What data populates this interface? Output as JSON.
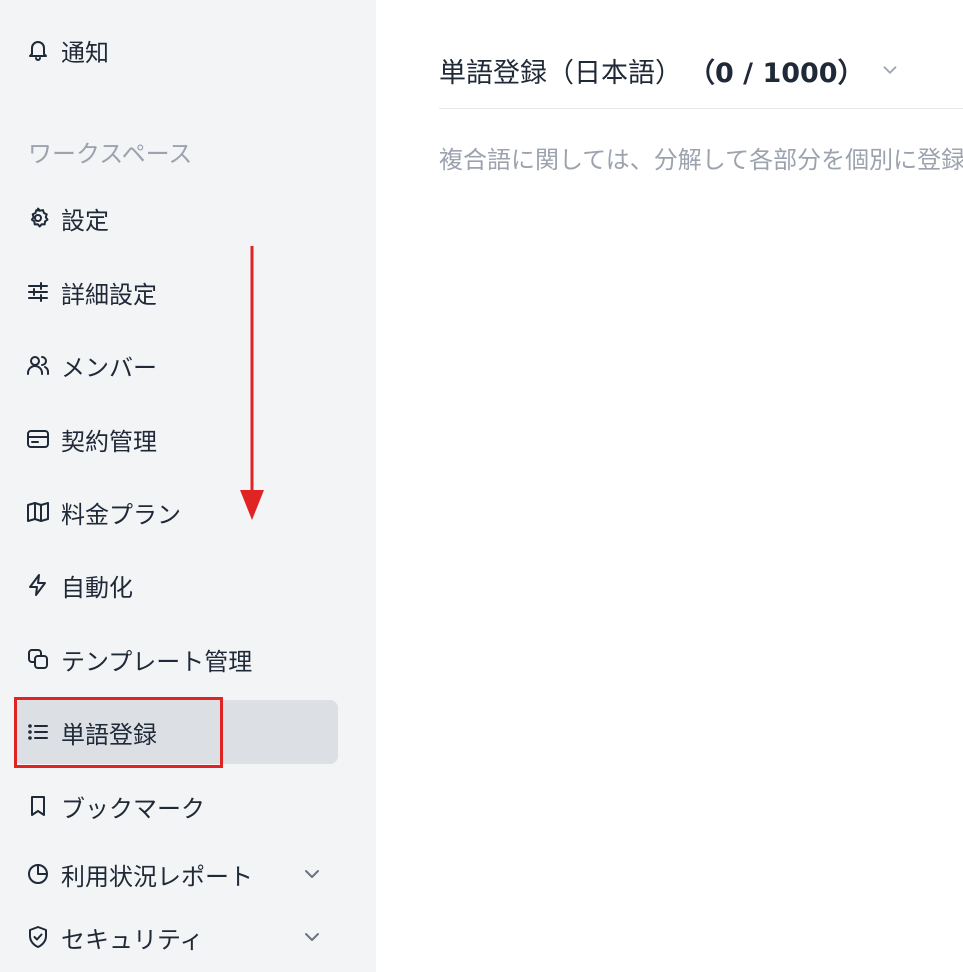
{
  "sidebar": {
    "notification": {
      "label": "通知",
      "icon": "bell-icon"
    },
    "section_heading": "ワークスペース",
    "items": [
      {
        "label": "設定",
        "icon": "gear-icon"
      },
      {
        "label": "詳細設定",
        "icon": "sliders-icon"
      },
      {
        "label": "メンバー",
        "icon": "users-icon"
      },
      {
        "label": "契約管理",
        "icon": "credit-card-icon"
      },
      {
        "label": "料金プラン",
        "icon": "map-icon"
      },
      {
        "label": "自動化",
        "icon": "lightning-icon"
      },
      {
        "label": "テンプレート管理",
        "icon": "copy-icon"
      },
      {
        "label": "単語登録",
        "icon": "list-icon",
        "active": true
      },
      {
        "label": "ブックマーク",
        "icon": "bookmark-icon"
      },
      {
        "label": "利用状況レポート",
        "icon": "pie-chart-icon",
        "expandable": true
      },
      {
        "label": "セキュリティ",
        "icon": "shield-check-icon",
        "expandable": true
      }
    ]
  },
  "main": {
    "title": "単語登録（日本語）",
    "count": "（0 / 1000）",
    "description": "複合語に関しては、分解して各部分を個別に登録"
  },
  "colors": {
    "sidebar_bg": "#f3f4f6",
    "active_bg": "#dcdfe4",
    "annotation_red": "#e02424",
    "muted_text": "#9ca3af"
  }
}
